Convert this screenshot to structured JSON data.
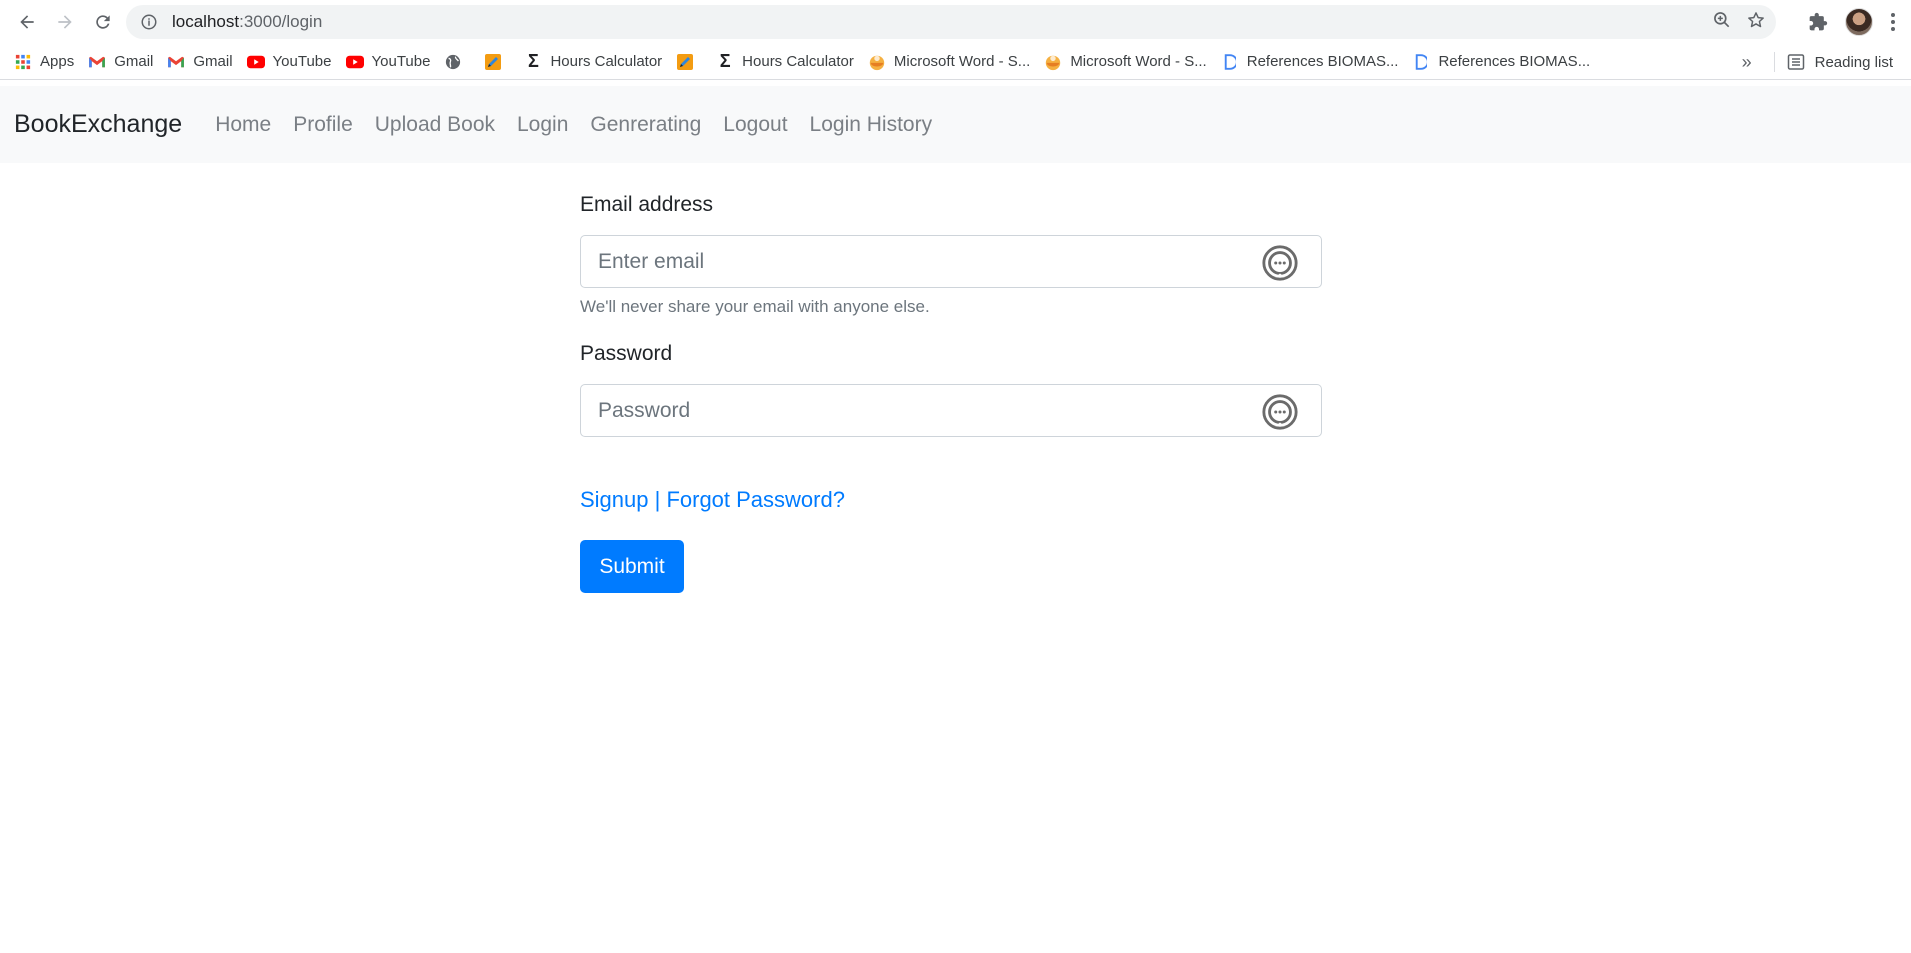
{
  "browser": {
    "url_host": "localhost",
    "url_path": ":3000/login",
    "bookmarks": [
      {
        "label": "Apps",
        "icon": "apps-grid-icon"
      },
      {
        "label": "Gmail",
        "icon": "gmail-icon"
      },
      {
        "label": "Gmail",
        "icon": "gmail-icon"
      },
      {
        "label": "YouTube",
        "icon": "youtube-icon"
      },
      {
        "label": "YouTube",
        "icon": "youtube-icon"
      },
      {
        "label": "",
        "icon": "globe-icon"
      },
      {
        "label": "",
        "icon": "pencil-icon"
      },
      {
        "label": "Hours Calculator",
        "icon": "sigma-icon"
      },
      {
        "label": "",
        "icon": "pencil-icon"
      },
      {
        "label": "Hours Calculator",
        "icon": "sigma-icon"
      },
      {
        "label": "Microsoft Word - S...",
        "icon": "word-icon"
      },
      {
        "label": "Microsoft Word - S...",
        "icon": "word-icon"
      },
      {
        "label": "References BIOMAS...",
        "icon": "doc-d-icon"
      },
      {
        "label": "References BIOMAS...",
        "icon": "doc-d-icon"
      }
    ],
    "more_bookmarks": "»",
    "reading_list": "Reading list"
  },
  "navbar": {
    "brand": "BookExchange",
    "links": [
      "Home",
      "Profile",
      "Upload Book",
      "Login",
      "Genrerating",
      "Logout",
      "Login History"
    ]
  },
  "form": {
    "email_label": "Email address",
    "email_placeholder": "Enter email",
    "email_value": "",
    "email_help": "We'll never share your email with anyone else.",
    "password_label": "Password",
    "password_placeholder": "Password",
    "password_value": "",
    "links_text": "Signup | Forgot Password?",
    "submit_label": "Submit"
  },
  "colors": {
    "primary": "#007bff",
    "navbar_bg": "#f8f9fa",
    "muted": "#6c757d"
  }
}
